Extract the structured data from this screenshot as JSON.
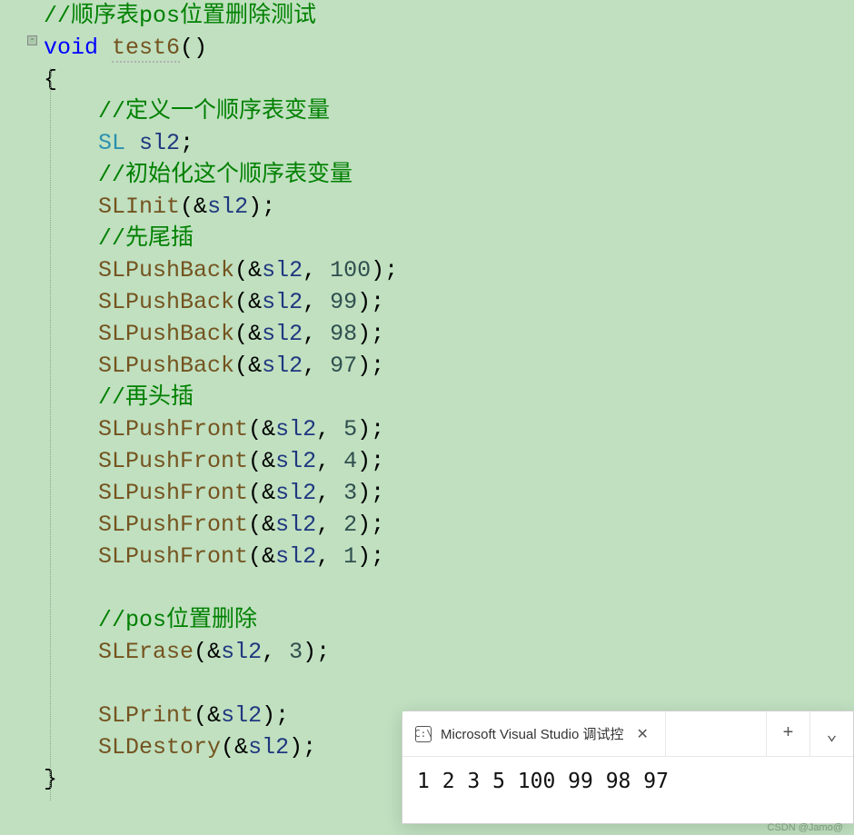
{
  "code": {
    "c1": "//顺序表pos位置删除测试",
    "kw_void": "void",
    "fn_name": "test6",
    "paren_open": "(",
    "paren_close": ")",
    "brace_open": "{",
    "c2": "//定义一个顺序表变量",
    "type_sl": "SL",
    "var_sl2": "sl2",
    "semi": ";",
    "c3": "//初始化这个顺序表变量",
    "fn_init": "SLInit",
    "amp": "&",
    "c4": "//先尾插",
    "fn_pushback": "SLPushBack",
    "comma": ",",
    "sp": " ",
    "n100": "100",
    "n99": "99",
    "n98": "98",
    "n97": "97",
    "c5": "//再头插",
    "fn_pushfront": "SLPushFront",
    "n5": "5",
    "n4": "4",
    "n3": "3",
    "n2": "2",
    "n1": "1",
    "c6": "//pos位置删除",
    "fn_erase": "SLErase",
    "fn_print": "SLPrint",
    "fn_destroy": "SLDestory",
    "brace_close": "}"
  },
  "gutter": {
    "collapse": "-"
  },
  "debug": {
    "icon": "C:\\",
    "title": "Microsoft Visual Studio 调试控",
    "close": "✕",
    "plus": "+",
    "chev": "⌄",
    "output": "1 2 3 5 100 99 98 97"
  },
  "watermark": "CSDN @Jamo@"
}
